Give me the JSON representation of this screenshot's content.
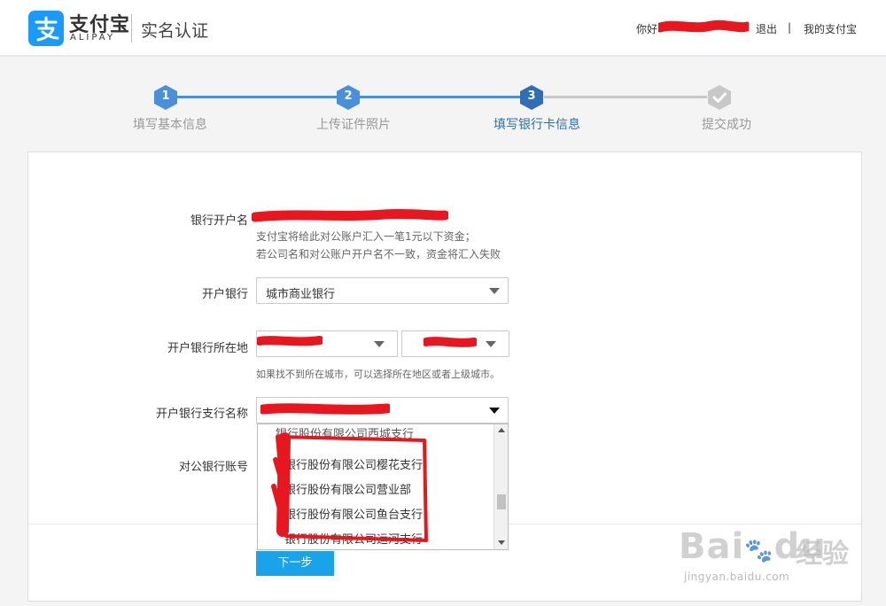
{
  "header": {
    "logo_cn": "支付宝",
    "logo_en": "ALIPAY",
    "page_title": "实名认证",
    "greeting": "你好",
    "logout": "退出",
    "separator": "|",
    "my_alipay": "我的支付宝"
  },
  "steps": [
    {
      "num": "1",
      "label": "填写基本信息",
      "state": "done"
    },
    {
      "num": "2",
      "label": "上传证件照片",
      "state": "done"
    },
    {
      "num": "3",
      "label": "填写银行卡信息",
      "state": "active"
    },
    {
      "num": "",
      "label": "提交成功",
      "state": "pending"
    }
  ],
  "colors": {
    "step_done": "#4a8fd9",
    "step_active": "#2f6eb5",
    "step_pending": "#c8c8c8",
    "button": "#1aa3e8",
    "redact": "#e8171f"
  },
  "form": {
    "account_name_label": "银行开户名",
    "account_name_hint_1": "支付宝将给此对公账户汇入一笔1元以下资金；",
    "account_name_hint_2": "若公司名和对公账户开户名不一致，资金将汇入失败",
    "bank_label": "开户银行",
    "bank_value": "城市商业银行",
    "location_label": "开户银行所在地",
    "location_hint": "如果找不到所在城市，可以选择所在地区或者上级城市。",
    "branch_label": "开户银行支行名称",
    "account_no_label": "对公银行账号",
    "branch_options": [
      "银行股份有限公司西城支行",
      "银行股份有限公司樱花支行",
      "银行股份有限公司营业部",
      "银行股份有限公司鱼台支行",
      "银行股份有限公司运河支行"
    ],
    "next_button": "下一步"
  },
  "watermark": {
    "brand": "Bai",
    "brand2": "du",
    "cn": "经验",
    "url": "jingyan.baidu.com"
  }
}
